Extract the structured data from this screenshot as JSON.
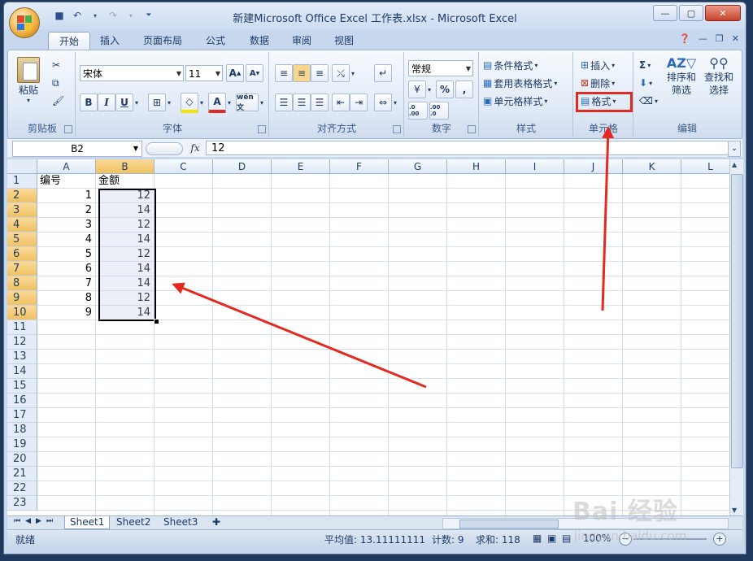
{
  "window": {
    "title": "新建Microsoft Office Excel 工作表.xlsx - Microsoft Excel"
  },
  "tabs": [
    "开始",
    "插入",
    "页面布局",
    "公式",
    "数据",
    "审阅",
    "视图"
  ],
  "clipboard": {
    "paste_label": "粘贴",
    "group_label": "剪贴板"
  },
  "font": {
    "name": "宋体",
    "size": "11",
    "group_label": "字体",
    "phonetic_label": "wén 文"
  },
  "alignment": {
    "group_label": "对齐方式"
  },
  "number": {
    "format": "常规",
    "percent": "%",
    "comma": ",",
    "inc_decimal": ".0 .00",
    "dec_decimal": ".00 .0",
    "group_label": "数字"
  },
  "styles": {
    "conditional": "条件格式",
    "table_format": "套用表格格式",
    "cell_styles": "单元格样式",
    "group_label": "样式"
  },
  "cells": {
    "insert": "插入",
    "delete": "删除",
    "format": "格式",
    "group_label": "单元格"
  },
  "editing": {
    "sum": "Σ",
    "sort_filter": "排序和\n筛选",
    "find_select": "查找和\n选择",
    "group_label": "编辑"
  },
  "formula_bar": {
    "name_box": "B2",
    "fx": "fx",
    "value": "12"
  },
  "columns": [
    "A",
    "B",
    "C",
    "D",
    "E",
    "F",
    "G",
    "H",
    "I",
    "J",
    "K",
    "L"
  ],
  "rows": [
    "1",
    "2",
    "3",
    "4",
    "5",
    "6",
    "7",
    "8",
    "9",
    "10",
    "11",
    "12",
    "13",
    "14",
    "15",
    "16",
    "17",
    "18",
    "19",
    "20",
    "21",
    "22",
    "23"
  ],
  "sheet": {
    "header_a": "编号",
    "header_b": "金额",
    "col_a": [
      "1",
      "2",
      "3",
      "4",
      "5",
      "6",
      "7",
      "8",
      "9"
    ],
    "col_b": [
      "12",
      "14",
      "12",
      "14",
      "12",
      "14",
      "14",
      "12",
      "14"
    ]
  },
  "sheet_tabs": [
    "Sheet1",
    "Sheet2",
    "Sheet3"
  ],
  "status": {
    "ready": "就绪",
    "average": "平均值: 13.11111111",
    "count": "计数: 9",
    "sum": "求和: 118",
    "zoom": "100%"
  },
  "watermark": {
    "logo": "Bai 经验",
    "url": "jingyan.baidu.com"
  },
  "colors": {
    "accent_red": "#e32a21",
    "selection": "#f1c15f",
    "ribbon": "#dfe9f6"
  }
}
